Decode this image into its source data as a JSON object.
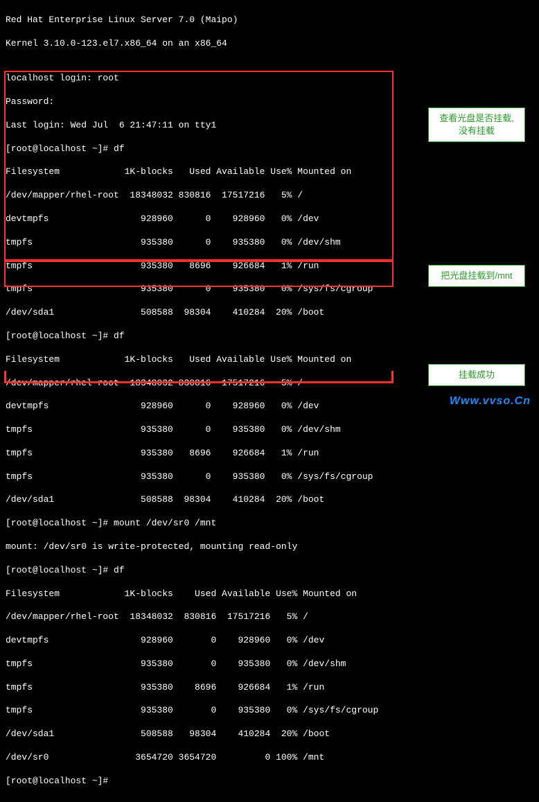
{
  "header": {
    "line1": "Red Hat Enterprise Linux Server 7.0 (Maipo)",
    "line2": "Kernel 3.10.0-123.el7.x86_64 on an x86_64",
    "blank": "",
    "login": "localhost login: root",
    "password": "Password:",
    "lastlogin": "Last login: Wed Jul  6 21:47:11 on tty1"
  },
  "section1": {
    "prompt": "[root@localhost ~]# df",
    "hdr": "Filesystem            1K-blocks   Used Available Use% Mounted on",
    "rows": [
      "/dev/mapper/rhel-root  18348032 830816  17517216   5% /",
      "devtmpfs                 928960      0    928960   0% /dev",
      "tmpfs                    935380      0    935380   0% /dev/shm",
      "tmpfs                    935380   8696    926684   1% /run",
      "tmpfs                    935380      0    935380   0% /sys/fs/cgroup",
      "/dev/sda1                508588  98304    410284  20% /boot"
    ]
  },
  "section1b": {
    "prompt": "[root@localhost ~]# df",
    "hdr": "Filesystem            1K-blocks   Used Available Use% Mounted on",
    "rows": [
      "/dev/mapper/rhel-root  18348032 830816  17517216   5% /",
      "devtmpfs                 928960      0    928960   0% /dev",
      "tmpfs                    935380      0    935380   0% /dev/shm",
      "tmpfs                    935380   8696    926684   1% /run",
      "tmpfs                    935380      0    935380   0% /sys/fs/cgroup",
      "/dev/sda1                508588  98304    410284  20% /boot"
    ]
  },
  "mount": {
    "cmd": "[root@localhost ~]# mount /dev/sr0 /mnt",
    "msg": "mount: /dev/sr0 is write-protected, mounting read-only"
  },
  "section2": {
    "prompt": "[root@localhost ~]# df",
    "hdr": "Filesystem            1K-blocks    Used Available Use% Mounted on",
    "rows": [
      "/dev/mapper/rhel-root  18348032  830816  17517216   5% /",
      "devtmpfs                 928960       0    928960   0% /dev",
      "tmpfs                    935380       0    935380   0% /dev/shm",
      "tmpfs                    935380    8696    926684   1% /run",
      "tmpfs                    935380       0    935380   0% /sys/fs/cgroup",
      "/dev/sda1                508588   98304    410284  20% /boot",
      "/dev/sr0                3654720 3654720         0 100% /mnt"
    ]
  },
  "final_prompt": "[root@localhost ~]#",
  "annotations": {
    "a1_line1": "查看光盘是否挂载,",
    "a1_line2": "没有挂载",
    "a2": "把光盘挂载到/mnt",
    "a3": "挂载成功"
  },
  "watermark": "Www.vvso.Cn"
}
